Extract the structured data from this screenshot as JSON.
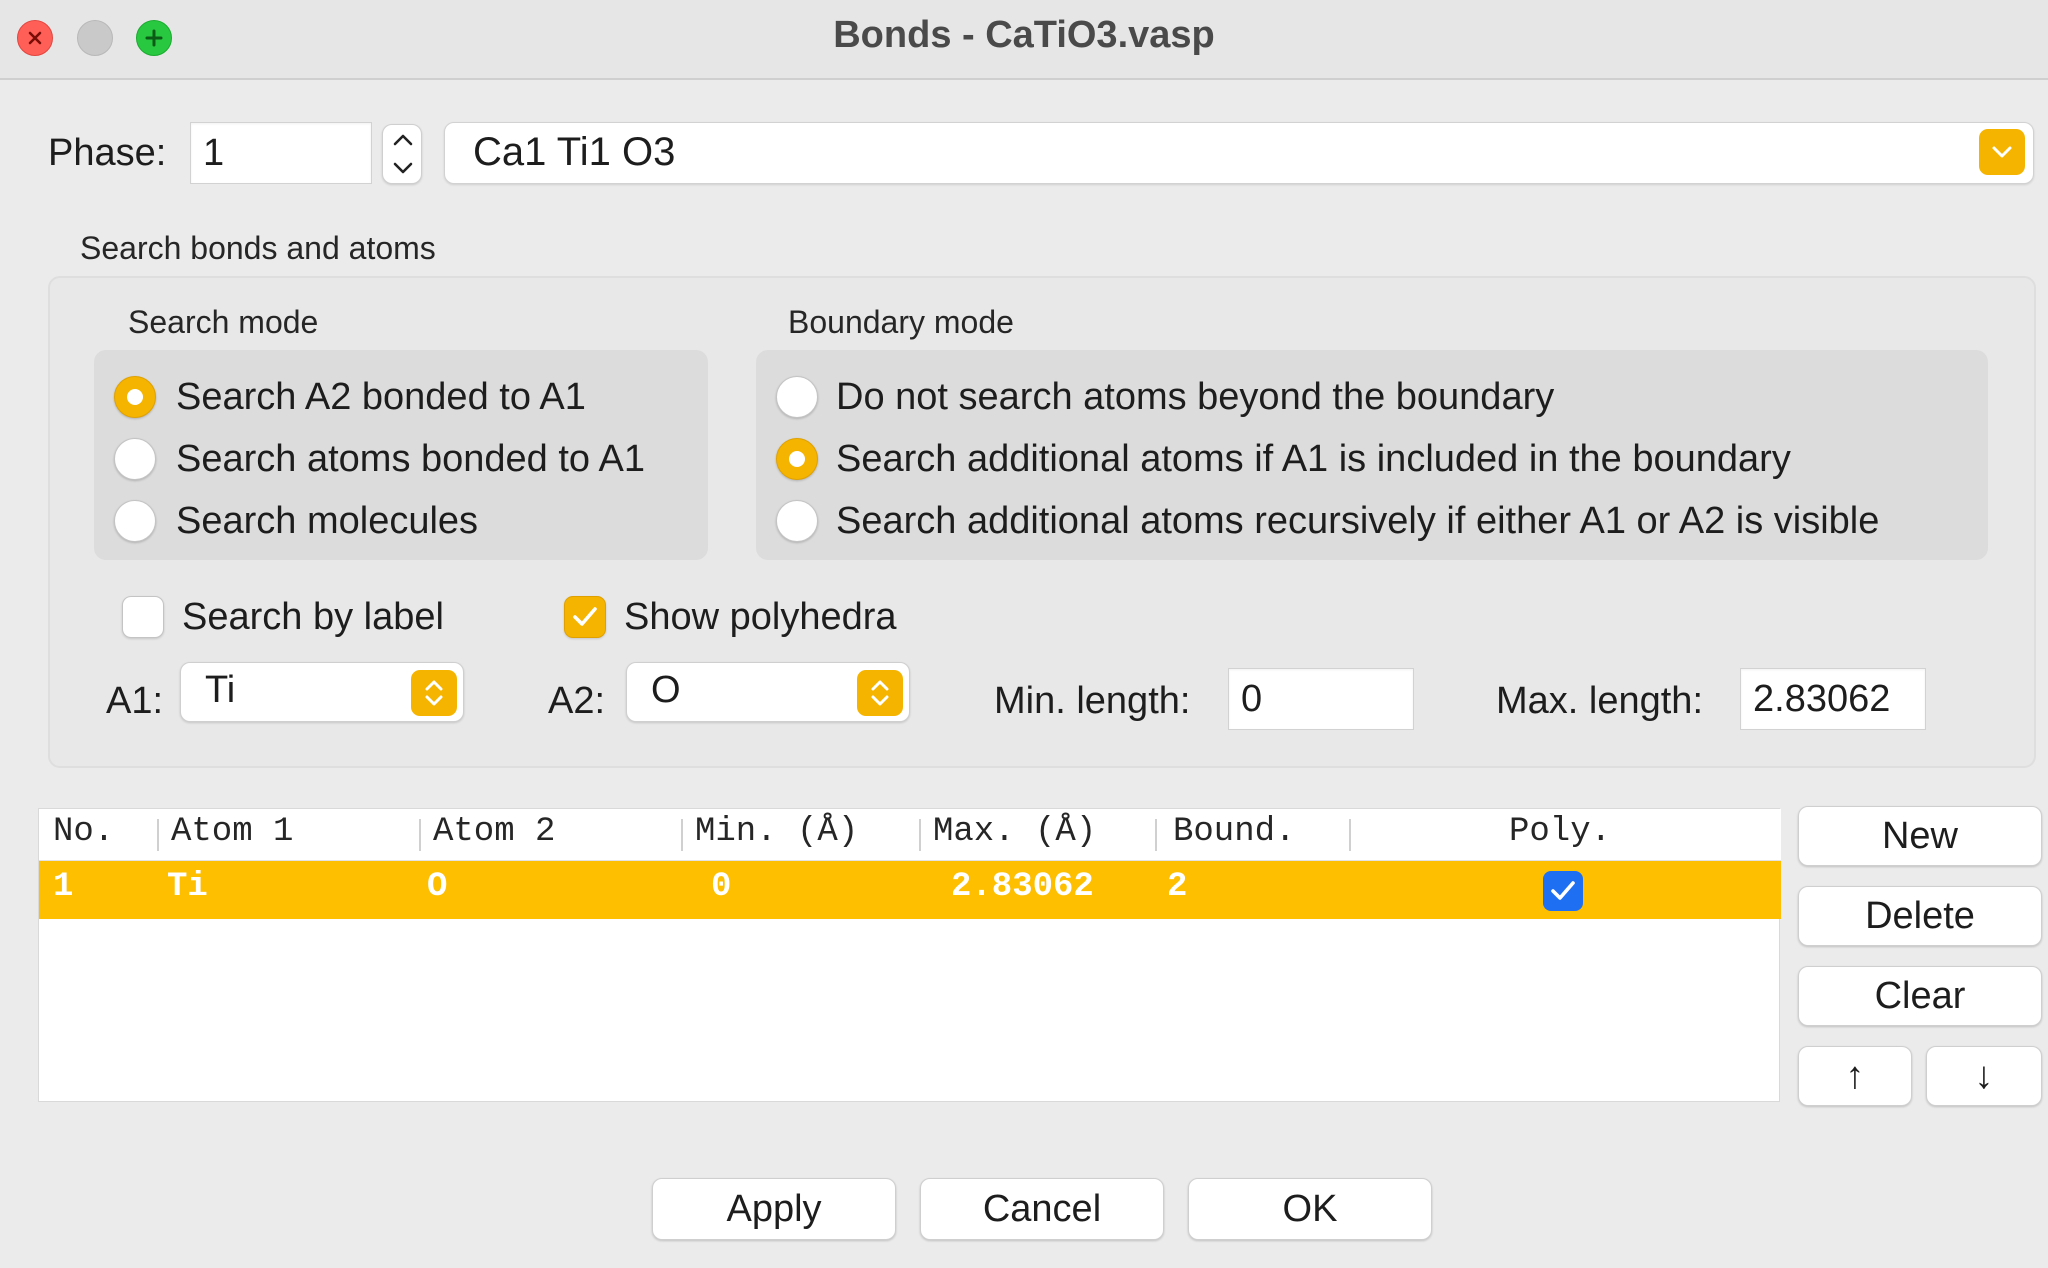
{
  "window": {
    "title": "Bonds - CaTiO3.vasp"
  },
  "phase": {
    "label": "Phase:",
    "value": "1",
    "composition": "Ca1 Ti1 O3"
  },
  "search_group": {
    "title": "Search bonds and atoms",
    "search_mode": {
      "title": "Search mode",
      "options": [
        "Search A2 bonded to A1",
        "Search atoms bonded to A1",
        "Search molecules"
      ],
      "selected": 0
    },
    "boundary_mode": {
      "title": "Boundary mode",
      "options": [
        "Do not search atoms beyond the boundary",
        "Search additional atoms if A1 is included in the boundary",
        "Search additional atoms recursively if either A1 or A2 is visible"
      ],
      "selected": 1
    },
    "search_by_label": {
      "label": "Search by label",
      "checked": false
    },
    "show_polyhedra": {
      "label": "Show polyhedra",
      "checked": true
    },
    "a1": {
      "label": "A1:",
      "value": "Ti"
    },
    "a2": {
      "label": "A2:",
      "value": "O"
    },
    "min_length": {
      "label": "Min. length:",
      "value": "0"
    },
    "max_length": {
      "label": "Max. length:",
      "value": "2.83062"
    }
  },
  "table": {
    "columns": [
      "No.",
      "Atom 1",
      "Atom 2",
      "Min. (Å)",
      "Max. (Å)",
      "Bound.",
      "Poly."
    ],
    "rows": [
      {
        "no": "1",
        "atom1": "Ti",
        "atom2": "O",
        "min": "0",
        "max": "2.83062",
        "bound": "2",
        "poly": true
      }
    ]
  },
  "side_buttons": {
    "new": "New",
    "delete": "Delete",
    "clear": "Clear",
    "up": "↑",
    "down": "↓"
  },
  "footer": {
    "apply": "Apply",
    "cancel": "Cancel",
    "ok": "OK"
  },
  "colors": {
    "accent": "#f5b400",
    "selection": "#fdbf00",
    "check_blue": "#1f6ff2"
  }
}
